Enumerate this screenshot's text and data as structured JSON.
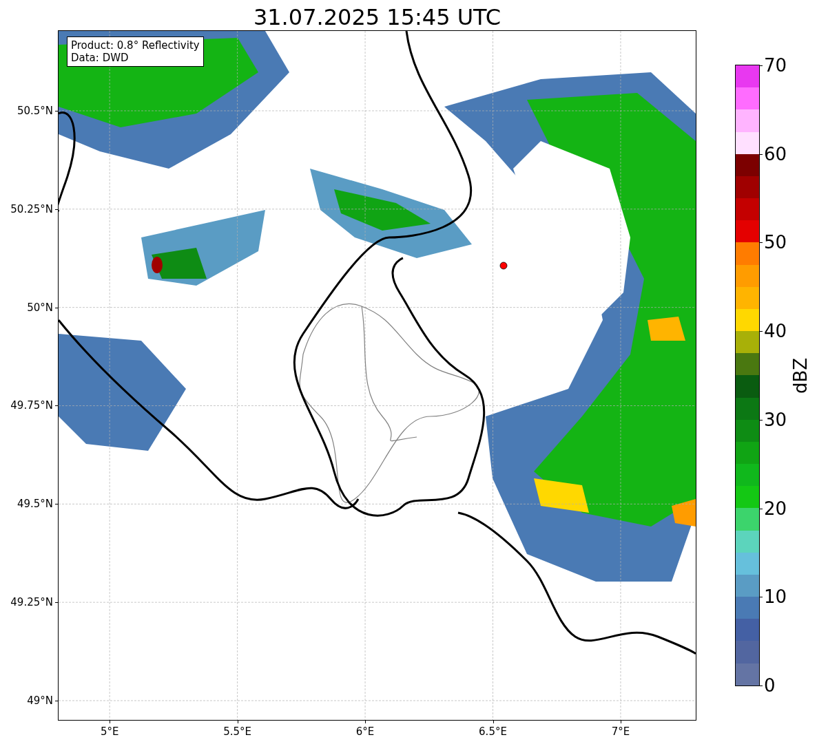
{
  "title": "31.07.2025 15:45 UTC",
  "legend": [
    "Product: 0.8° Reflectivity",
    "Data: DWD"
  ],
  "map": {
    "yticks": [
      "50.5°N",
      "50.25°N",
      "50°N",
      "49.75°N",
      "49.5°N",
      "49.25°N",
      "49°N"
    ],
    "xticks": [
      "5°E",
      "5.5°E",
      "6°E",
      "6.5°E",
      "7°E"
    ]
  },
  "colorbar": {
    "label": "dBZ",
    "ticks": [
      "70",
      "60",
      "50",
      "40",
      "30",
      "20",
      "10",
      "0"
    ],
    "segments": [
      {
        "color": "#e838f0"
      },
      {
        "color": "#ff6cff"
      },
      {
        "color": "#ffb4ff"
      },
      {
        "color": "#ffe0ff"
      },
      {
        "color": "#7c0000"
      },
      {
        "color": "#a00000"
      },
      {
        "color": "#c40000"
      },
      {
        "color": "#e40000"
      },
      {
        "color": "#ff7c00"
      },
      {
        "color": "#ff9c00"
      },
      {
        "color": "#ffb400"
      },
      {
        "color": "#ffd800"
      },
      {
        "color": "#a8b008"
      },
      {
        "color": "#4a7810"
      },
      {
        "color": "#0a5c10"
      },
      {
        "color": "#0c7814"
      },
      {
        "color": "#0e8c14"
      },
      {
        "color": "#10a414"
      },
      {
        "color": "#10b81c"
      },
      {
        "color": "#14c814"
      },
      {
        "color": "#3cd46c"
      },
      {
        "color": "#5cd4bc"
      },
      {
        "color": "#66c0dc"
      },
      {
        "color": "#5a9cc4"
      },
      {
        "color": "#4a7ab4"
      },
      {
        "color": "#4460a4"
      },
      {
        "color": "#5266a0"
      },
      {
        "color": "#6474a4"
      }
    ]
  }
}
